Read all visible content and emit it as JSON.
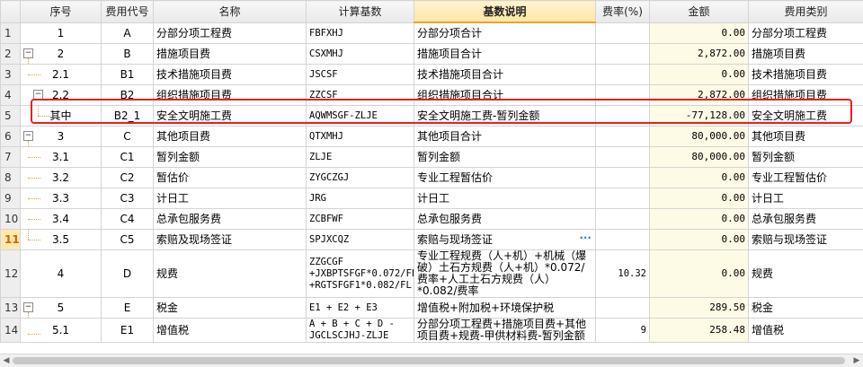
{
  "columns": [
    "序号",
    "费用代号",
    "名称",
    "计算基数",
    "基数说明",
    "费率(%)",
    "金额",
    "费用类别"
  ],
  "rows": [
    {
      "n": "1",
      "seq": "1",
      "code": "A",
      "name": "分部分项工程费",
      "base": "FBFXHJ",
      "desc": "分部分项合计",
      "rate": "",
      "amount": "0.00",
      "cat": "分部分项工程费"
    },
    {
      "n": "2",
      "seq": "2",
      "code": "B",
      "name": "措施项目费",
      "base": "CSXMHJ",
      "desc": "措施项目合计",
      "rate": "",
      "amount": "2,872.00",
      "cat": "措施项目费"
    },
    {
      "n": "3",
      "seq": "2.1",
      "code": "B1",
      "name": "技术措施项目费",
      "base": "JSCSF",
      "desc": "技术措施项目合计",
      "rate": "",
      "amount": "0.00",
      "cat": "技术措施项目费"
    },
    {
      "n": "4",
      "seq": "2.2",
      "code": "B2",
      "name": "组织措施项目费",
      "base": "ZZCSF",
      "desc": "组织措施项目合计",
      "rate": "",
      "amount": "2,872.00",
      "cat": "组织措施项目费"
    },
    {
      "n": "5",
      "seq": "其中",
      "code": "B2_1",
      "name": "安全文明施工费",
      "base": "AQWMSGF-ZLJE",
      "desc": "安全文明施工费-暂列金额",
      "rate": "",
      "amount": "-77,128.00",
      "cat": "安全文明施工费"
    },
    {
      "n": "6",
      "seq": "3",
      "code": "C",
      "name": "其他项目费",
      "base": "QTXMHJ",
      "desc": "其他项目合计",
      "rate": "",
      "amount": "80,000.00",
      "cat": "其他项目费"
    },
    {
      "n": "7",
      "seq": "3.1",
      "code": "C1",
      "name": "暂列金额",
      "base": "ZLJE",
      "desc": "暂列金额",
      "rate": "",
      "amount": "80,000.00",
      "cat": "暂列金额"
    },
    {
      "n": "8",
      "seq": "3.2",
      "code": "C2",
      "name": "暂估价",
      "base": "ZYGCZGJ",
      "desc": "专业工程暂估价",
      "rate": "",
      "amount": "0.00",
      "cat": "专业工程暂估价"
    },
    {
      "n": "9",
      "seq": "3.3",
      "code": "C3",
      "name": "计日工",
      "base": "JRG",
      "desc": "计日工",
      "rate": "",
      "amount": "0.00",
      "cat": "计日工"
    },
    {
      "n": "10",
      "seq": "3.4",
      "code": "C4",
      "name": "总承包服务费",
      "base": "ZCBFWF",
      "desc": "总承包服务费",
      "rate": "",
      "amount": "0.00",
      "cat": "总承包服务费"
    },
    {
      "n": "11",
      "seq": "3.5",
      "code": "C5",
      "name": "索赔及现场签证",
      "base": "SPJXCQZ",
      "desc": "索赔与现场签证",
      "rate": "",
      "amount": "0.00",
      "cat": "索赔与现场签证"
    },
    {
      "n": "12",
      "seq": "4",
      "code": "D",
      "name": "规费",
      "base": "ZZGCGF +JXBPTSFGF*0.072/FL +RGTSFGF1*0.082/FL",
      "desc": "专业工程规费（人+机）+机械（爆破）土石方规费（人+机）*0.072/费率+人工土石方规费（人）*0.082/费率",
      "rate": "10.32",
      "amount": "0.00",
      "cat": "规费"
    },
    {
      "n": "13",
      "seq": "5",
      "code": "E",
      "name": "税金",
      "base": "E1 + E2 + E3",
      "desc": "增值税+附加税+环境保护税",
      "rate": "",
      "amount": "289.50",
      "cat": "税金"
    },
    {
      "n": "14",
      "seq": "5.1",
      "code": "E1",
      "name": "增值税",
      "base": "A + B + C + D - JGCLSCJHJ-ZLJE",
      "desc": "分部分项工程费+措施项目费+其他项目费+规费-甲供材料费-暂列金额",
      "rate": "9",
      "amount": "258.48",
      "cat": "增值税"
    }
  ]
}
